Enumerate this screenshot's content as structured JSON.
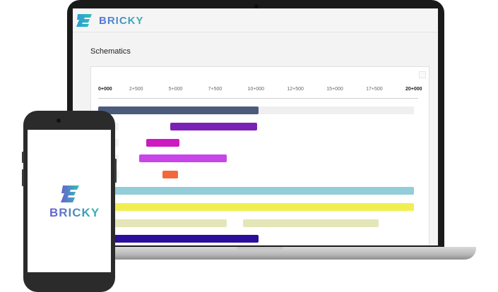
{
  "app": {
    "brand": "BRICKY",
    "logo_icon": "bricky-logo-icon"
  },
  "page": {
    "title": "Schematics"
  },
  "chart_data": {
    "type": "gantt-bars",
    "axis_ticks": [
      "0+000",
      "2+500",
      "5+000",
      "7+500",
      "10+000",
      "12+500",
      "15+000",
      "17+500",
      "20+000"
    ],
    "x_range": [
      0,
      20000
    ],
    "rows": [
      {
        "track": true,
        "segments": [
          {
            "start": 0,
            "end": 10150,
            "color": "#4a5b7c"
          }
        ]
      },
      {
        "track": false,
        "segments": [
          {
            "start": 4550,
            "end": 10050,
            "color": "#7b22b5"
          }
        ]
      },
      {
        "track": false,
        "segments": [
          {
            "start": 3050,
            "end": 5150,
            "color": "#cc19c2"
          }
        ]
      },
      {
        "track": false,
        "segments": [
          {
            "start": 2600,
            "end": 8150,
            "color": "#c845ea"
          }
        ]
      },
      {
        "track": false,
        "segments": [
          {
            "start": 4050,
            "end": 5050,
            "color": "#f5673b"
          }
        ]
      },
      {
        "track": true,
        "segments": [
          {
            "start": 0,
            "end": 20000,
            "color": "#92cdd8"
          }
        ]
      },
      {
        "track": true,
        "segments": [
          {
            "start": 0,
            "end": 20000,
            "color": "#f0ef52"
          }
        ]
      },
      {
        "track": false,
        "segments": [
          {
            "start": 0,
            "end": 8150,
            "color": "#e5e6b7"
          },
          {
            "start": 9150,
            "end": 17750,
            "color": "#e5e6b7"
          }
        ]
      },
      {
        "track": false,
        "segments": [
          {
            "start": 0,
            "end": 10150,
            "color": "#2b0e9c"
          }
        ]
      }
    ]
  }
}
